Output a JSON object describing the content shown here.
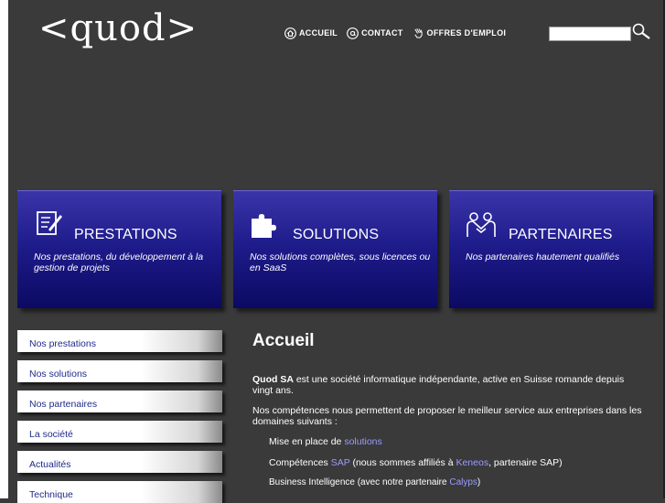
{
  "header": {
    "logo_text": "<quod>",
    "nav": [
      {
        "label": "ACCUEIL",
        "icon": "home-icon"
      },
      {
        "label": "CONTACT",
        "icon": "at-icon"
      },
      {
        "label": "OFFRES D'EMPLOI",
        "icon": "hand-icon"
      }
    ],
    "search": {
      "value": "",
      "placeholder": "",
      "button_icon": "magnifier-icon"
    }
  },
  "cards": [
    {
      "title": "PRESTATIONS",
      "description": "Nos prestations, du développement à la gestion de projets",
      "icon": "notepad-pen-icon"
    },
    {
      "title": "SOLUTIONS",
      "description": "Nos solutions complètes, sous licences ou en SaaS",
      "icon": "puzzle-piece-icon"
    },
    {
      "title": "PARTENAIRES",
      "description": "Nos partenaires hautement qualifiés",
      "icon": "handshake-icon"
    }
  ],
  "sidebar": {
    "items": [
      {
        "label": "Nos prestations"
      },
      {
        "label": "Nos solutions"
      },
      {
        "label": "Nos partenaires"
      },
      {
        "label": "La société"
      },
      {
        "label": "Actualités"
      },
      {
        "label": "Technique"
      }
    ]
  },
  "content": {
    "title": "Accueil",
    "intro_company": "Quod SA",
    "intro_rest": " est une société informatique indépendante, active en Suisse romande depuis vingt ans.",
    "competences_intro": "Nos compétences nous permettent de proposer le meilleur service aux entreprises dans les domaines suivants :",
    "bullets": [
      {
        "before": "Mise en place de ",
        "link": "solutions",
        "after": ""
      },
      {
        "before": "Compétences ",
        "link": "SAP",
        "middle": " (nous sommes affiliés à ",
        "link2": "Keneos",
        "after": ", partenaire SAP)"
      },
      {
        "before": "Business Intelligence (avec notre partenaire ",
        "link": "Calyps",
        "after": ")"
      }
    ]
  },
  "colors": {
    "background": "#3a3a3a",
    "card_top": "#3a35a8",
    "card_bottom": "#0b0a62",
    "sidebar_text": "#1f2a8a",
    "link": "#9a9cff"
  }
}
